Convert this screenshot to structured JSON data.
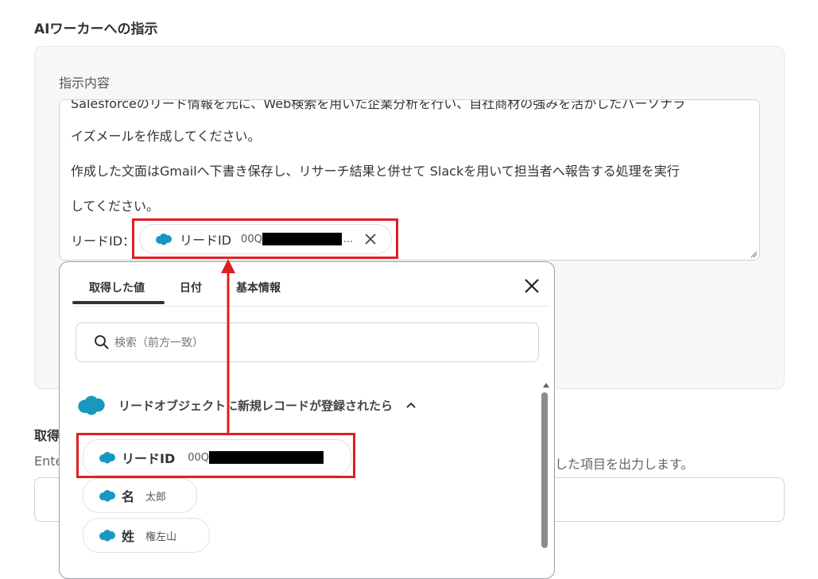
{
  "section": {
    "title": "AIワーカーへの指示"
  },
  "panel": {
    "label": "指示内容"
  },
  "textarea": {
    "line1": "Salesforceのリード情報を元に、Web検索を用いた企業分析を行い、自社商材の強みを活かしたパーソナラ",
    "line2": "イズメールを作成してください。",
    "line3": "作成した文面はGmailへ下書き保存し、リサーチ結果と併せて Slackを用いて担当者へ報告する処理を実行",
    "line4": "してください。",
    "line5_prefix": "リードID：",
    "chip_label": "リードID",
    "chip_value": "00Q",
    "chip_ellipsis": "..."
  },
  "below": {
    "title": "取得",
    "desc_left": "Ente",
    "desc_right": "した項目を出力します。"
  },
  "popup": {
    "tabs": [
      "取得した値",
      "日付",
      "基本情報"
    ],
    "search_placeholder": "検索（前方一致）",
    "group_label": "リードオブジェクトに新規レコードが登録されたら",
    "items": [
      {
        "label": "リードID",
        "value": "00Q"
      },
      {
        "label": "名",
        "value": "太郎"
      },
      {
        "label": "姓",
        "value": "権左山"
      }
    ]
  },
  "colors": {
    "salesforce": "#1798c1",
    "highlight": "#e02020",
    "accent": "#333333"
  },
  "icons": [
    "salesforce-cloud-icon",
    "close-icon",
    "search-icon",
    "chevron-up-icon"
  ]
}
